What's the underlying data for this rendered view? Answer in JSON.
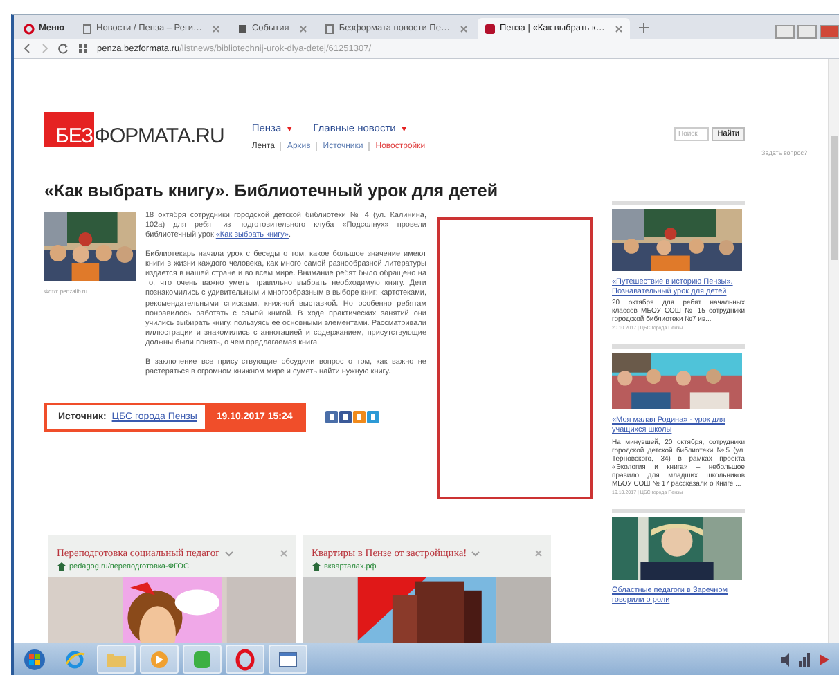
{
  "browser": {
    "tabs": [
      {
        "label": "Меню",
        "kind": "menu",
        "selected": false
      },
      {
        "label": "Новости / Пенза – Реги…",
        "kind": "page",
        "selected": false
      },
      {
        "label": "События",
        "kind": "doc",
        "selected": false
      },
      {
        "label": "Безформата новости Пе…",
        "kind": "page",
        "selected": false
      },
      {
        "label": "Пенза | «Как выбрать к…",
        "kind": "site",
        "selected": true
      }
    ],
    "url_host": "penza.bezformata.ru",
    "url_path": "/listnews/bibliotechnij-urok-dlya-detej/61251307/"
  },
  "site": {
    "logo_mark": "БЕЗ",
    "logo_text": "ФОРМАТА.RU",
    "nav": [
      {
        "label": "Пенза",
        "caret": "▼"
      },
      {
        "label": "Главные новости",
        "caret": "▼"
      }
    ],
    "subnav": [
      {
        "label": "Лента",
        "kind": "plain"
      },
      {
        "label": "Архив",
        "kind": "link"
      },
      {
        "label": "Источники",
        "kind": "link"
      },
      {
        "label": "Новостройки",
        "kind": "accent"
      }
    ],
    "search": {
      "placeholder": "Поиск",
      "button": "Найти",
      "link": "Задать вопрос?"
    }
  },
  "article": {
    "title": "«Как выбрать книгу». Библиотечный урок для детей",
    "photo_caption": "Фото: penzalib.ru",
    "lead": {
      "before": "18 октября сотрудники городской детской библиотеки № 4 (ул. Калинина, 102а) для ребят из подготовительного клуба «Подсолнух» провели библиотечный урок ",
      "link": "«Как выбрать книгу»",
      "after": "."
    },
    "paragraphs": [
      "Библиотекарь начала урок с беседы о том, какое большое значение имеют книги в жизни каждого человека, как много самой разнообразной литературы издается в нашей стране и во всем мире. Внимание ребят было обращено на то, что очень важно уметь правильно выбрать необходимую книгу. Дети познакомились с удивительным и многообразным в выборе книг: картотеками, рекомендательными списками, книжной выставкой. Но особенно ребятам понравилось работать с самой книгой. В ходе практических занятий они учились выбирать книгу, пользуясь ее основными элементами. Рассматривали иллюстрации и знакомились с аннотацией и содержанием, присутствующие должны были понять, о чем предлагаемая книга.",
      "В заключение все присутствующие обсудили вопрос о том, как важно не растеряться в огромном книжном мире и суметь найти нужную книгу."
    ],
    "source_label": "Источник:",
    "source_link": "ЦБС города Пензы",
    "date": "19.10.2017 15:24",
    "share": [
      {
        "color": "#4a6ea8"
      },
      {
        "color": "#3b5998"
      },
      {
        "color": "#f08a1c"
      },
      {
        "color": "#2d9ad6"
      }
    ]
  },
  "sidebar": [
    {
      "title": "«Путешествие в историю Пензы». Познавательный урок для детей",
      "text": "20 октября для ребят начальных классов МБОУ СОШ № 15 сотрудники городской библиотеки №7 ив...",
      "meta": "20.10.2017 | ЦБС города Пензы"
    },
    {
      "title": "«Моя малая Родина» - урок для учащихся школы",
      "text": "На минувшей, 20 октября, сотрудники городской детской библиотеки №5 (ул. Терновского, 34) в рамках проекта «Экология и книга» – небольшое правило для младших школьников МБОУ СОШ № 17 рассказали о Книге ...",
      "meta": "19.10.2017 | ЦБС города Пензы"
    },
    {
      "title": "Областные педагоги в Заречном говорили о роли"
    }
  ],
  "ads": [
    {
      "title": "Переподготовка социальный педагог",
      "domain": "pedagog.ru/переподготовка-ФГОС"
    },
    {
      "title": "Квартиры в Пензе от застройщика!",
      "domain": "вкварталах.рф"
    }
  ],
  "taskbar": [
    {
      "kind": "start"
    },
    {
      "kind": "ie"
    },
    {
      "kind": "folder"
    },
    {
      "kind": "media"
    },
    {
      "kind": "chat"
    },
    {
      "kind": "opera"
    },
    {
      "kind": "app"
    }
  ]
}
